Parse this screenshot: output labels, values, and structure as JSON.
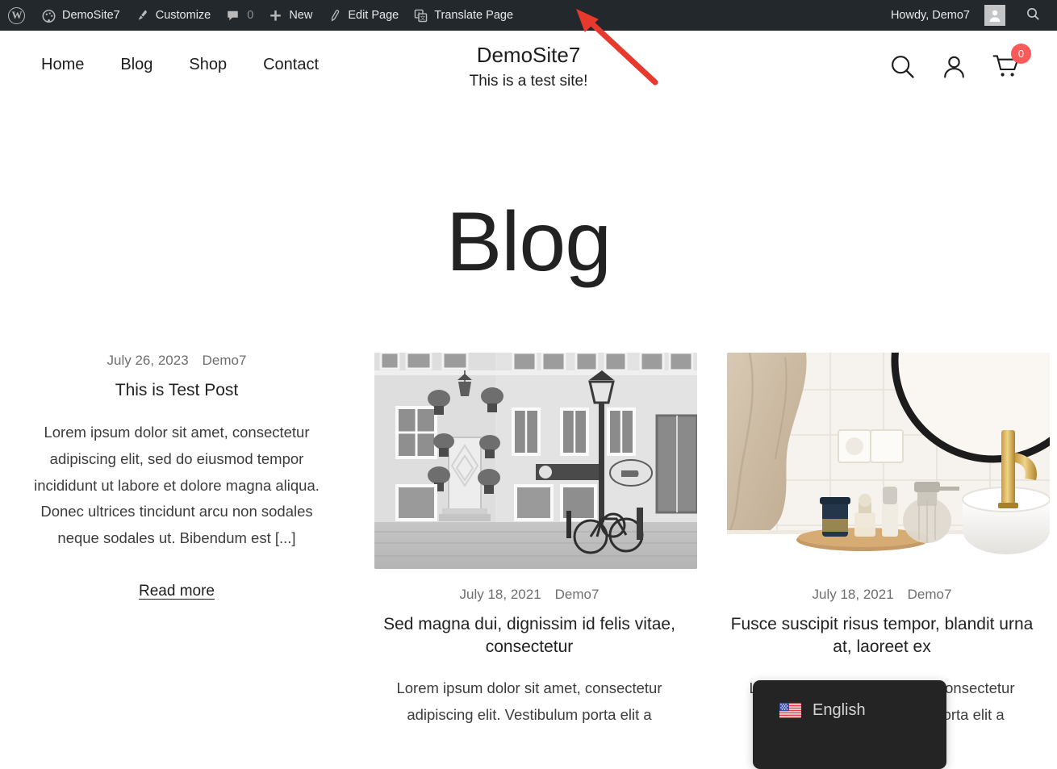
{
  "adminbar": {
    "wp_logo": "wordpress-logo-icon",
    "site_name": "DemoSite7",
    "customize": "Customize",
    "comment_count": "0",
    "new": "New",
    "edit_page": "Edit Page",
    "translate_page": "Translate Page",
    "howdy": "Howdy, Demo7",
    "search": "search-icon"
  },
  "header": {
    "nav": [
      {
        "label": "Home"
      },
      {
        "label": "Blog"
      },
      {
        "label": "Shop"
      },
      {
        "label": "Contact"
      }
    ],
    "site_title": "DemoSite7",
    "tagline": "This is a test site!",
    "cart_count": "0",
    "cart_badge_color": "#fc5a5a"
  },
  "main": {
    "page_title": "Blog",
    "posts": [
      {
        "date": "July 26, 2023",
        "author": "Demo7",
        "title": "This is Test Post",
        "excerpt": "Lorem ipsum dolor sit amet, consectetur adipiscing elit, sed do eiusmod tempor incididunt ut labore et dolore magna aliqua. Donec ultrices tincidunt arcu non sodales neque sodales ut. Bibendum est [...]",
        "read_more": "Read more",
        "thumbnail": null
      },
      {
        "date": "July 18, 2021",
        "author": "Demo7",
        "title": "Sed magna dui, dignissim id felis vitae, consectetur",
        "excerpt": "Lorem ipsum dolor sit amet, consectetur adipiscing elit. Vestibulum porta elit a",
        "thumbnail": "black-and-white-street-building-photo"
      },
      {
        "date": "July 18, 2021",
        "author": "Demo7",
        "title": "Fusce suscipit risus tempor, blandit urna at, laoreet ex",
        "excerpt": "Lorem ipsum dolor sit amet, consectetur adipiscing elit. Vestibulum porta elit a",
        "thumbnail": "bathroom-sink-with-towel-photo"
      }
    ]
  },
  "language_switcher": {
    "flag": "us-flag-icon",
    "label": "English"
  },
  "annotation": {
    "arrow_color": "#e8392d",
    "points_to": "Translate Page"
  }
}
